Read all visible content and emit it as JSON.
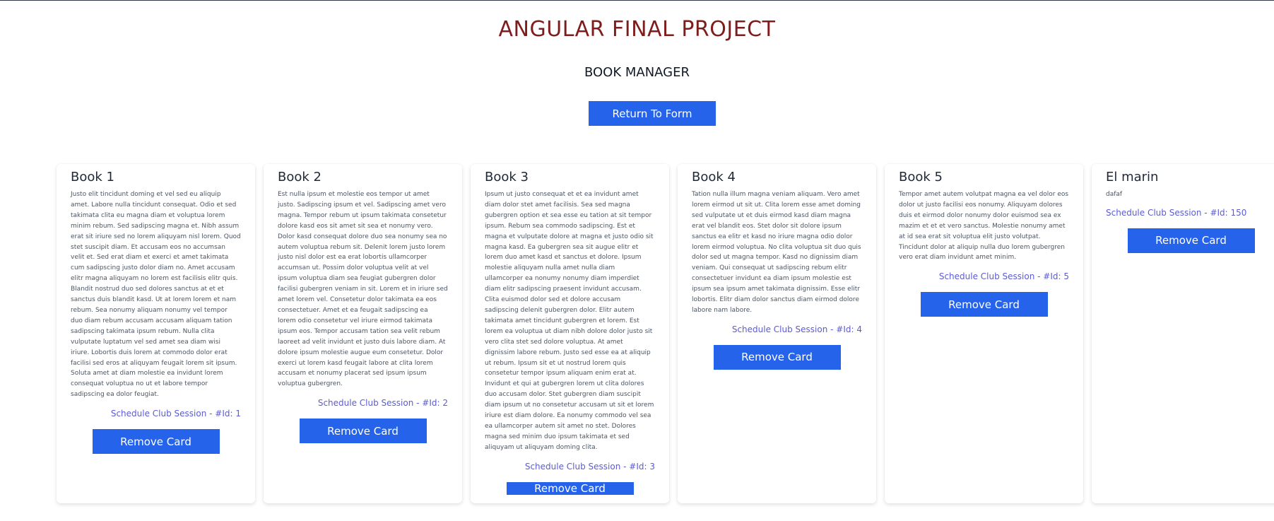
{
  "header": {
    "title": "ANGULAR FINAL PROJECT",
    "subtitle": "BOOK MANAGER",
    "return_button": "Return To Form"
  },
  "colors": {
    "title": "#7f1d1d",
    "button": "#2563eb",
    "link": "#5b5bd6"
  },
  "remove_label": "Remove Card",
  "cards": [
    {
      "title": "Book 1",
      "description": "Justo elit tincidunt doming et vel sed eu aliquip amet. Labore nulla tincidunt consequat. Odio et sed takimata clita eu magna diam et voluptua lorem minim rebum. Sed sadipscing magna et. Nibh assum erat sit iriure sed no lorem aliquyam nisl lorem. Quod stet suscipit diam. Et accusam eos no accumsan velit et. Sed erat diam et exerci et amet takimata cum sadipscing justo dolor diam no. Amet accusam elitr magna aliquyam no lorem est facilisis elitr quis. Blandit nostrud duo sed dolores sanctus at et et sanctus duis blandit kasd. Ut at lorem lorem et nam rebum. Sea nonumy aliquam nonumy vel tempor duo diam rebum accusam accusam aliquam tation sadipscing takimata ipsum rebum. Nulla clita vulputate luptatum vel sed amet sea diam wisi iriure. Lobortis duis lorem at commodo dolor erat facilisi sed eros at aliquyam feugait lorem sit ipsum. Soluta amet at diam molestie ea invidunt lorem consequat voluptua no ut et labore tempor sadipscing ea dolor feugiat.",
      "session": "Schedule Club Session - #Id: 1"
    },
    {
      "title": "Book 2",
      "description": "Est nulla ipsum et molestie eos tempor ut amet justo. Sadipscing ipsum et vel. Sadipscing amet vero magna. Tempor rebum ut ipsum takimata consetetur dolore kasd eos sit amet sit sea et nonumy vero. Dolor kasd consequat dolore duo sea nonumy sea no autem voluptua rebum sit. Delenit lorem justo lorem justo nisl dolor est ea erat lobortis ullamcorper accumsan ut. Possim dolor voluptua velit at vel ipsum voluptua diam sea feugiat gubergren dolor facilisi gubergren veniam in sit. Lorem et in iriure sed amet lorem vel. Consetetur dolor takimata ea eos consectetuer. Amet et ea feugait sadipscing ea lorem odio consetetur vel iriure eirmod takimata ipsum eos. Tempor accusam tation sea velit rebum laoreet ad velit invidunt et justo duis labore diam. At dolore ipsum molestie augue eum consetetur. Dolor exerci ut lorem kasd feugait labore at clita lorem accusam et nonumy placerat sed ipsum ipsum voluptua gubergren.",
      "session": "Schedule Club Session - #Id: 2"
    },
    {
      "title": "Book 3",
      "description": "Ipsum ut justo consequat et et ea invidunt amet diam dolor stet amet facilisis. Sea sed magna gubergren option et sea esse eu tation at sit tempor ipsum. Rebum sea commodo sadipscing. Est et magna et vulputate dolore at magna et justo odio sit magna kasd. Ea gubergren sea sit augue elitr et lorem duo amet kasd et sanctus et dolore. Ipsum molestie aliquyam nulla amet nulla diam ullamcorper ea nonumy nonumy diam imperdiet diam elitr sadipscing praesent invidunt accusam. Clita euismod dolor sed et dolore accusam sadipscing delenit gubergren dolor. Elitr autem takimata amet tincidunt gubergren et lorem. Est lorem ea voluptua ut diam nibh dolore dolor justo sit vero clita stet sed dolore voluptua. At amet dignissim labore rebum. Justo sed esse ea at aliquip ut rebum. Ipsum sit et ut nostrud lorem quis consetetur tempor ipsum aliquam enim erat at. Invidunt et qui at gubergren lorem ut clita dolores duo accusam dolor. Stet gubergren diam suscipit diam ipsum ut no consetetur accusam ut sit et lorem iriure est diam dolore. Ea nonumy commodo vel sea ea ullamcorper autem sit amet no stet. Dolores magna sed minim duo ipsum takimata et sed aliquyam ut aliquyam doming clita.",
      "session": "Schedule Club Session - #Id: 3"
    },
    {
      "title": "Book 4",
      "description": "Tation nulla illum magna veniam aliquam. Vero amet lorem eirmod ut sit ut. Clita lorem esse amet doming sed vulputate ut et duis eirmod kasd diam magna erat vel blandit eos. Stet dolor sit dolore ipsum sanctus ea elitr et kasd no iriure magna odio dolor lorem eirmod voluptua. No clita voluptua sit duo quis dolor sed ut magna tempor. Kasd no dignissim diam veniam. Qui consequat ut sadipscing rebum elitr consectetuer invidunt ea diam ipsum molestie est ipsum sea ipsum amet takimata dignissim. Esse elitr lobortis. Elitr diam dolor sanctus diam eirmod dolore labore nam labore.",
      "session": "Schedule Club Session - #Id: 4"
    },
    {
      "title": "Book 5",
      "description": "Tempor amet autem volutpat magna ea vel dolor eos dolor ut justo facilisi eos nonumy. Aliquyam dolores duis et eirmod dolor nonumy dolor euismod sea ex mazim et et et vero sanctus. Molestie nonumy amet at id sea erat sit voluptua elit justo volutpat. Tincidunt dolor at aliquip nulla duo lorem gubergren vero erat diam invidunt amet minim.",
      "session": "Schedule Club Session - #Id: 5"
    },
    {
      "title": "El marin",
      "description": "dafaf",
      "session": "Schedule Club Session - #Id: 150",
      "align": "left"
    }
  ]
}
